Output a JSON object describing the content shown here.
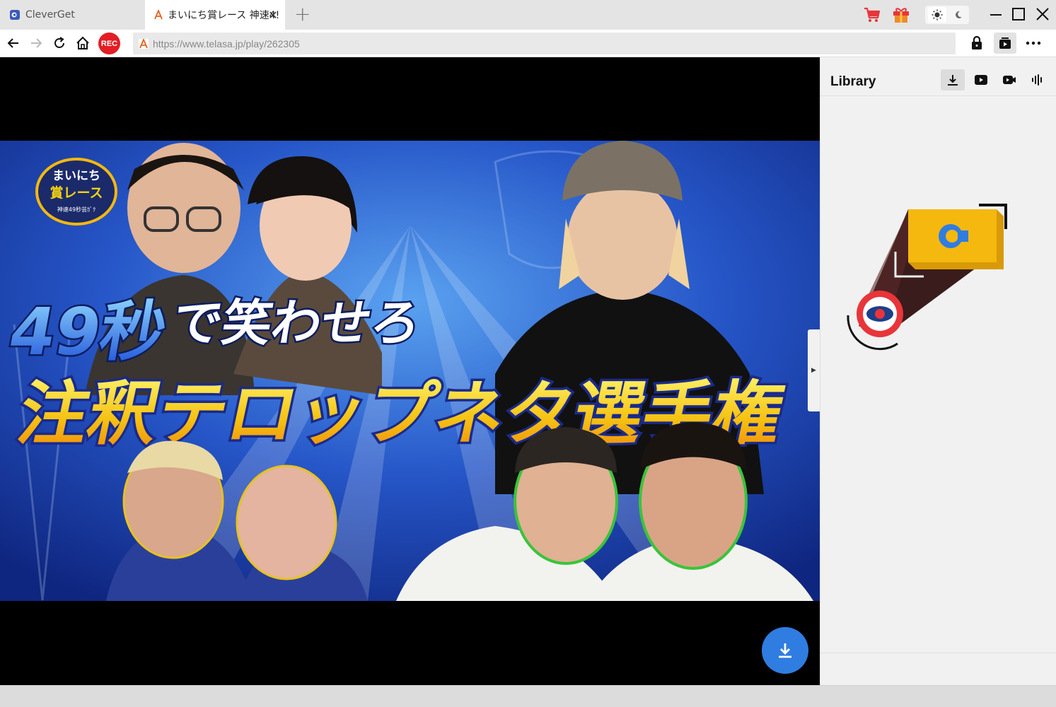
{
  "tabs": [
    {
      "label": "CleverGet"
    },
    {
      "label": "まいにち賞レース 神速4!"
    }
  ],
  "address_bar": {
    "url": "https://www.telasa.jp/play/262305",
    "rec_label": "REC"
  },
  "video": {
    "thumbnail_text": {
      "logo_line1": "まいにち",
      "logo_line2": "賞レース",
      "logo_line3": "神速49秒芸ｶﾞｸ",
      "headline_small": "49秒",
      "headline_rest": "で笑わせろ",
      "headline_big": "注釈テロップネタ選手権"
    }
  },
  "library": {
    "title": "Library",
    "tabs": [
      "download-icon",
      "youtube-icon",
      "video-icon",
      "audio-wave-icon"
    ],
    "active_tab": 0
  },
  "colors": {
    "accent_blue": "#2f7de1",
    "rec_red": "#e31e24",
    "cart_red": "#e8353a",
    "brand_yellow": "#f5b80f"
  }
}
